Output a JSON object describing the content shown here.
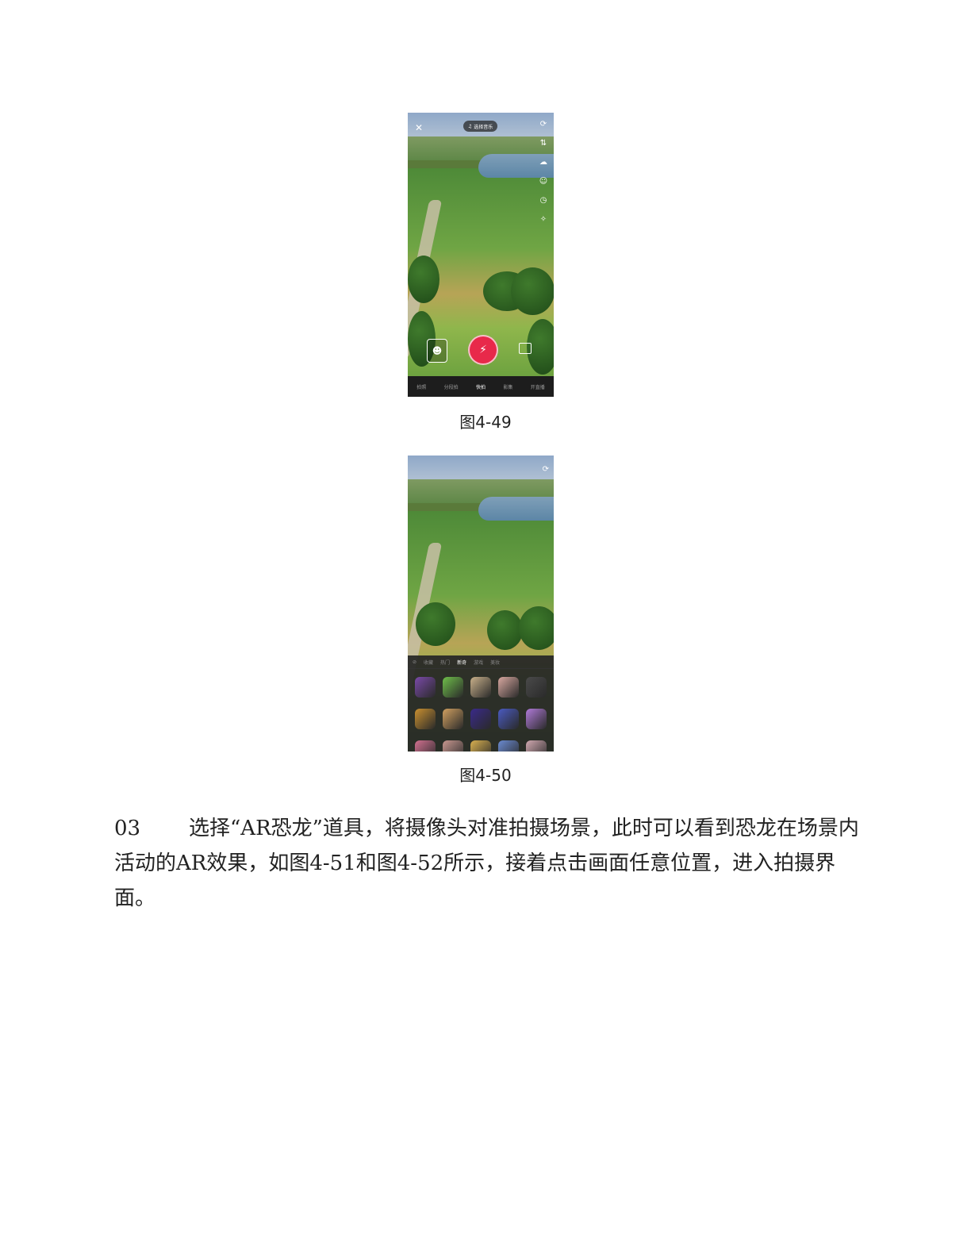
{
  "figure1": {
    "music_label": "选择音乐",
    "modes": [
      {
        "label": "拍照",
        "active": false
      },
      {
        "label": "分段拍",
        "active": false
      },
      {
        "label": "快拍",
        "active": true
      },
      {
        "label": "影集",
        "active": false
      },
      {
        "label": "开直播",
        "active": false
      }
    ],
    "caption": "图4-49"
  },
  "figure2": {
    "effect_categories": [
      {
        "label": "收藏",
        "active": false
      },
      {
        "label": "热门",
        "active": false
      },
      {
        "label": "新奇",
        "active": true
      },
      {
        "label": "游戏",
        "active": false
      },
      {
        "label": "美妆",
        "active": false
      }
    ],
    "effect_colors": [
      "#7a4aa8",
      "#6fbf4a",
      "#c8b08a",
      "#d8a8a0",
      "#4a4a4a",
      "#c89030",
      "#d0a060",
      "#3a2a8a",
      "#4a5ac0",
      "#b07ad8",
      "#d07090",
      "#c89890",
      "#d8b050",
      "#6a8ad0",
      "#d0a8b0"
    ],
    "caption": "图4-50"
  },
  "body": {
    "step_number": "03",
    "text": "选择“AR恐龙”道具，将摄像头对准拍摄场景，此时可以看到恐龙在场景内活动的AR效果，如图4-51和图4-52所示，接着点击画面任意位置，进入拍摄界面。"
  }
}
